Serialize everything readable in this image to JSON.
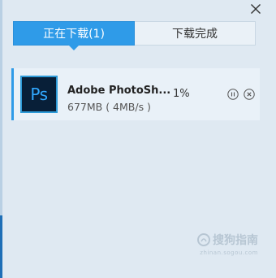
{
  "tabs": [
    {
      "label": "正在下载(1)",
      "active": true
    },
    {
      "label": "下载完成",
      "active": false
    }
  ],
  "download": {
    "icon_text": "Ps",
    "name": "Adobe PhotoSh...",
    "size_speed": "677MB ( 4MB/s )",
    "progress_text": "1%",
    "progress": 0.01
  },
  "watermark": {
    "main": "搜狗指南",
    "sub": "zhinan.sogou.com"
  },
  "colors": {
    "accent": "#2f9be8",
    "panel_bg": "#dfe9f2",
    "item_bg": "#e9f1f8"
  },
  "icons": [
    "close-icon",
    "pause-icon",
    "cancel-icon",
    "photoshop-icon",
    "sogou-logo-icon"
  ]
}
